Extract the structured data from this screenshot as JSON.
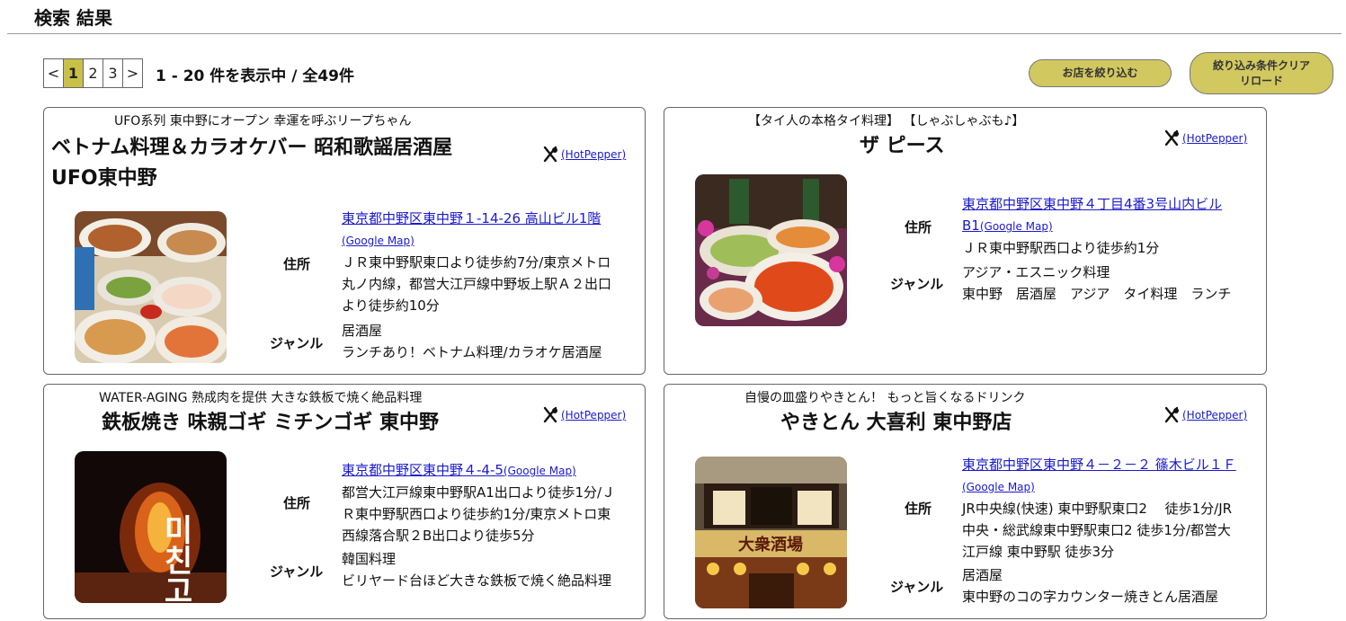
{
  "page": {
    "title": "検索 結果"
  },
  "pager": {
    "prev": "<",
    "pages": [
      "1",
      "2",
      "3"
    ],
    "next": ">",
    "count_text": "1 - 20 件を表示中 / 全49件"
  },
  "buttons": {
    "narrow": "お店を絞り込む",
    "clear_line1": "絞り込み条件クリア",
    "clear_line2": "リロード"
  },
  "labels": {
    "address": "住所",
    "genre": "ジャンル",
    "hotpepper": "(HotPepper)",
    "google_map": "(Google Map)"
  },
  "restaurants": [
    {
      "catch": "UFO系列 東中野にオープン 幸運を呼ぶリープちゃん",
      "name_line1": "ベトナム料理＆カラオケバー 昭和歌謡居酒屋",
      "name_line2": "UFO東中野",
      "address_link": "東京都中野区東中野１-14-26 高山ビル1階",
      "access": [
        "ＪＲ東中野駅東口より徒歩約7分/東京メトロ",
        "丸ノ内線，都営大江戸線中野坂上駅Ａ２出口",
        "より徒歩約10分"
      ],
      "genre": "居酒屋",
      "genre_note": "ランチあり！ベトナム料理/カラオケ居酒屋"
    },
    {
      "catch": "【タイ人の本格タイ料理】 【しゃぶしゃぶも♪】",
      "name_line1": "ザ ピース",
      "address_link_line1": "東京都中野区東中野４丁目4番3号山内ビル",
      "address_link_line2": "B1",
      "access": [
        "ＪＲ東中野駅西口より徒歩約1分"
      ],
      "genre": "アジア・エスニック料理",
      "genre_note": "東中野　居酒屋　アジア　タイ料理　ランチ"
    },
    {
      "catch": "WATER-AGING 熟成肉を提供 大きな鉄板で焼く絶品料理",
      "name_line1": "鉄板焼き 味親ゴギ ミチンゴギ 東中野",
      "address_link": "東京都中野区東中野４-4-5",
      "access": [
        "都営大江戸線東中野駅A1出口より徒歩1分/Ｊ",
        "Ｒ東中野駅西口より徒歩約1分/東京メトロ東",
        "西線落合駅２B出口より徒歩5分"
      ],
      "genre": "韓国料理",
      "genre_note": "ビリヤード台ほど大きな鉄板で焼く絶品料理"
    },
    {
      "catch": "自慢の皿盛りやきとん！ もっと旨くなるドリンク",
      "name_line1": "やきとん 大喜利 東中野店",
      "address_link": "東京都中野区東中野４－２－２ 篠木ビル１Ｆ",
      "access": [
        "JR中央線(快速) 東中野駅東口2　 徒歩1分/JR",
        "中央・総武線東中野駅東口2 徒歩1分/都営大",
        "江戸線 東中野駅 徒歩3分"
      ],
      "genre": "居酒屋",
      "genre_note": "東中野のコの字カウンター焼きとん居酒屋"
    }
  ],
  "photo_text": {
    "korean": "미친고기",
    "kanji_top": "大",
    "sign": "大衆酒場"
  },
  "colors": {
    "accent": "#d1c860",
    "pager_active": "#c9c04a",
    "link": "#1a1acc"
  }
}
